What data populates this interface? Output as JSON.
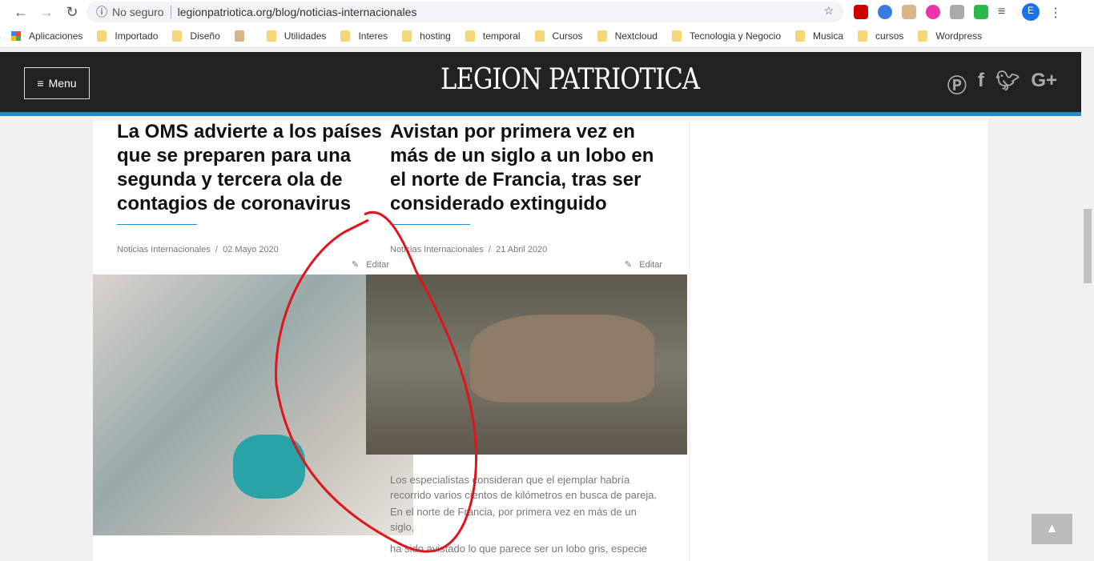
{
  "browser": {
    "url": "legionpatriotica.org/blog/noticias-internacionales",
    "security": "No seguro",
    "profile": "E",
    "bookmarks": [
      "Aplicaciones",
      "Importado",
      "Diseño",
      "Utilidades",
      "Interes",
      "hosting",
      "temporal",
      "Cursos",
      "Nextcloud",
      "Tecnologia y Negocio",
      "Musica",
      "cursos",
      "Wordpress"
    ]
  },
  "site": {
    "menu_label": "Menu",
    "logo": "LEGION PATRIOTICA"
  },
  "posts": [
    {
      "title": "La OMS advierte a los países que se preparen para una segunda y tercera ola de contagios de coronavirus",
      "category": "Noticias Internacionales",
      "date": "02 Mayo 2020",
      "edit": "Editar"
    },
    {
      "title": "Avistan por primera vez en más de un siglo a un lobo en el norte de Francia, tras ser considerado extinguido",
      "category": "Noticias Internacionales",
      "date": "21 Abril 2020",
      "edit": "Editar",
      "excerpt": [
        "Los especialistas consideran que el ejemplar habría recorrido varios cientos de kilómetros en busca de pareja.",
        "En el norte de Francia, por primera vez en más de un siglo,",
        "ha sido avistado lo que parece ser un lobo gris, especie"
      ]
    }
  ]
}
